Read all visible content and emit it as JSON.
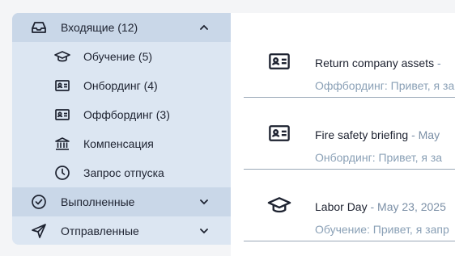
{
  "sidebar": {
    "inbox": {
      "label": "Входящие",
      "count": "(12)",
      "icon": "inbox-tray-icon",
      "state": "expanded"
    },
    "inbox_items": [
      {
        "label": "Обучение",
        "count": "(5)",
        "icon": "graduation-cap-icon"
      },
      {
        "label": "Онбординг",
        "count": "(4)",
        "icon": "id-card-icon"
      },
      {
        "label": "Оффбординг",
        "count": "(3)",
        "icon": "id-card-icon"
      },
      {
        "label": "Компенсация",
        "count": "",
        "icon": "bank-icon"
      },
      {
        "label": "Запрос отпуска",
        "count": "",
        "icon": "clock-icon"
      }
    ],
    "completed": {
      "label": "Выполненные",
      "icon": "check-circle-icon",
      "state": "collapsed"
    },
    "sent": {
      "label": "Отправленные",
      "icon": "send-icon",
      "state": "collapsed"
    }
  },
  "messages": [
    {
      "title": "Return company assets",
      "date": "- ",
      "preview": "Оффбординг: Привет, я за",
      "icon": "id-card-icon"
    },
    {
      "title": "Fire safety briefing",
      "date": "- May",
      "preview": "Онбординг: Привет, я за",
      "icon": "id-card-icon"
    },
    {
      "title": "Labor Day",
      "date": "- May 23, 2025",
      "preview": "Обучение: Привет, я запр",
      "icon": "graduation-cap-icon"
    }
  ],
  "colors": {
    "sidebar_bg": "#dce6f2",
    "sidebar_header_bg": "#c9d7e8",
    "text": "#1d2230",
    "muted": "#8aa0b6",
    "divider": "#9aa8b7"
  }
}
